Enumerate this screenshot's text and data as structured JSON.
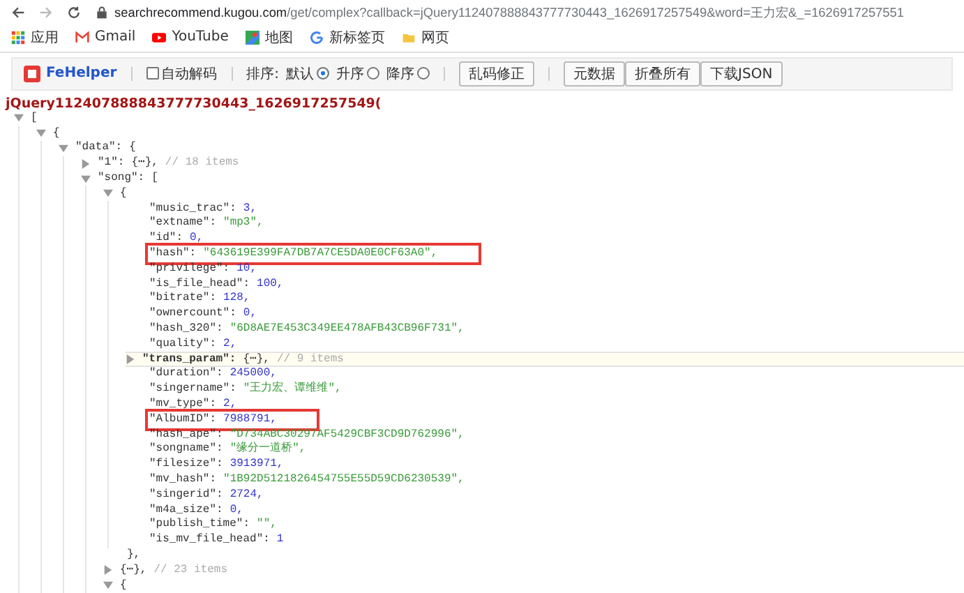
{
  "address_bar": {
    "url_host": "searchrecommend.kugou.com",
    "url_path": "/get/complex?callback=jQuery112407888843777730443_1626917257549&word=王力宏&_=1626917257551"
  },
  "bookmarks": [
    {
      "label": "应用",
      "kind": "apps"
    },
    {
      "label": "Gmail",
      "kind": "gmail"
    },
    {
      "label": "YouTube",
      "kind": "youtube"
    },
    {
      "label": "地图",
      "kind": "maps"
    },
    {
      "label": "新标签页",
      "kind": "google"
    },
    {
      "label": "网页",
      "kind": "folder"
    }
  ],
  "fehelper": {
    "logo": "FeHelper",
    "auto_decode": {
      "label": "自动解码",
      "checked": false
    },
    "sort_label": "排序:",
    "sort_options": [
      {
        "label": "默认",
        "selected": true
      },
      {
        "label": "升序",
        "selected": false
      },
      {
        "label": "降序",
        "selected": false
      }
    ],
    "fix_button": "乱码修正",
    "buttons": [
      "元数据",
      "折叠所有",
      "下载JSON"
    ]
  },
  "callback": "jQuery112407888843777730443_1626917257549(",
  "tree": [
    {
      "kind": "branch",
      "open": "[",
      "expanded": true,
      "hovered": false,
      "children": [
        {
          "kind": "branch",
          "open": "{",
          "expanded": true,
          "hovered": false,
          "children": [
            {
              "kind": "branch",
              "key": "\"data\":",
              "open": "{",
              "expanded": true,
              "hovered": false,
              "children": [
                {
                  "kind": "branch",
                  "key": "\"1\":",
                  "summary": "{⋯},",
                  "comment": "// 18 items",
                  "expanded": false,
                  "hovered": false
                },
                {
                  "kind": "branch",
                  "key": "\"song\":",
                  "open": "[",
                  "expanded": true,
                  "hovered": false,
                  "children": [
                    {
                      "kind": "branch",
                      "open": "{",
                      "expanded": true,
                      "hovered": false,
                      "close": "},",
                      "children": [
                        {
                          "kind": "number",
                          "key": "\"music_trac\":",
                          "value": "3,",
                          "marked": false
                        },
                        {
                          "kind": "string",
                          "key": "\"extname\":",
                          "value": "\"mp3\",",
                          "marked": false
                        },
                        {
                          "kind": "number",
                          "key": "\"id\":",
                          "value": "0,",
                          "marked": false
                        },
                        {
                          "kind": "string",
                          "key": "\"hash\":",
                          "value": "\"643619E399FA7DB7A7CE5DA0E0CF63A0\",",
                          "marked": true
                        },
                        {
                          "kind": "number",
                          "key": "\"privilege\":",
                          "value": "10,",
                          "marked": false
                        },
                        {
                          "kind": "number",
                          "key": "\"is_file_head\":",
                          "value": "100,",
                          "marked": false
                        },
                        {
                          "kind": "number",
                          "key": "\"bitrate\":",
                          "value": "128,",
                          "marked": false
                        },
                        {
                          "kind": "number",
                          "key": "\"ownercount\":",
                          "value": "0,",
                          "marked": false
                        },
                        {
                          "kind": "string",
                          "key": "\"hash_320\":",
                          "value": "\"6D8AE7E453C349EE478AFB43CB96F731\",",
                          "marked": false
                        },
                        {
                          "kind": "number",
                          "key": "\"quality\":",
                          "value": "2,",
                          "marked": false
                        },
                        {
                          "kind": "branch",
                          "key": "\"trans_param\":",
                          "summary": "{⋯},",
                          "comment": "// 9 items",
                          "expanded": false,
                          "hovered": true
                        },
                        {
                          "kind": "number",
                          "key": "\"duration\":",
                          "value": "245000,",
                          "marked": false
                        },
                        {
                          "kind": "string",
                          "key": "\"singername\":",
                          "value": "\"王力宏、谭维维\",",
                          "marked": false
                        },
                        {
                          "kind": "number",
                          "key": "\"mv_type\":",
                          "value": "2,",
                          "marked": false
                        },
                        {
                          "kind": "number",
                          "key": "\"AlbumID\":",
                          "value": "7988791,",
                          "marked": true
                        },
                        {
                          "kind": "string",
                          "key": "\"hash_ape\":",
                          "value": "\"D734ABC30297AF5429CBF3CD9D762996\",",
                          "marked": false
                        },
                        {
                          "kind": "string",
                          "key": "\"songname\":",
                          "value": "\"缘分一道桥\",",
                          "marked": false
                        },
                        {
                          "kind": "number",
                          "key": "\"filesize\":",
                          "value": "3913971,",
                          "marked": false
                        },
                        {
                          "kind": "string",
                          "key": "\"mv_hash\":",
                          "value": "\"1B92D5121826454755E55D59CD6230539\",",
                          "marked": false
                        },
                        {
                          "kind": "number",
                          "key": "\"singerid\":",
                          "value": "2724,",
                          "marked": false
                        },
                        {
                          "kind": "number",
                          "key": "\"m4a_size\":",
                          "value": "0,",
                          "marked": false
                        },
                        {
                          "kind": "string",
                          "key": "\"publish_time\":",
                          "value": "\"\",",
                          "marked": false
                        },
                        {
                          "kind": "number",
                          "key": "\"is_mv_file_head\":",
                          "value": "1",
                          "marked": false
                        }
                      ]
                    },
                    {
                      "kind": "branch",
                      "summary": "{⋯},",
                      "comment": "// 23 items",
                      "expanded": false,
                      "hovered": false
                    },
                    {
                      "kind": "branch",
                      "open": "{",
                      "expanded": true,
                      "hovered": false
                    }
                  ]
                }
              ]
            }
          ]
        }
      ]
    }
  ]
}
